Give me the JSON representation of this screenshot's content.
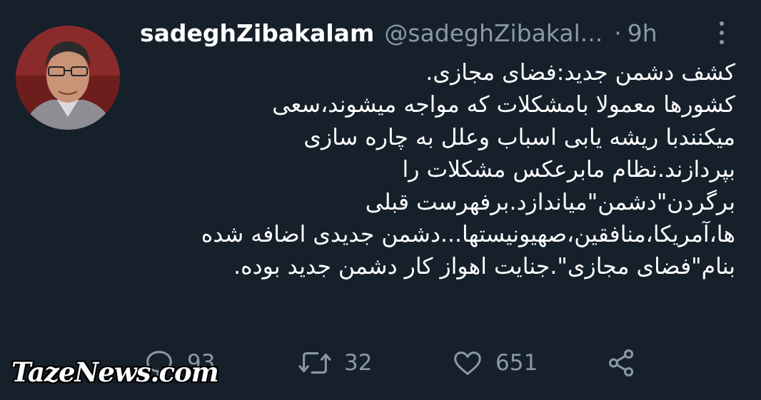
{
  "author": {
    "display_name": "sadeghZibakalam",
    "handle": "@sadeghZibakal...",
    "separator": "·",
    "time": "9h"
  },
  "tweet": {
    "lines": [
      "کشف دشمن جدید:فضای مجازی.",
      " کشورها معمولا بامشکلات که مواجه میشوند،سعی",
      "میکنندبا ریشه یابی اسباب وعلل به چاره سازی",
      "بپردازند.نظام مابرعکس مشکلات را",
      "برگردن\"دشمن\"میاندازد.برفهرست قبلی",
      "ها،آمریکا،منافقین،صهیونیستها...دشمن جدیدی اضافه شده",
      "بنام\"فضای مجازی\".جنایت اهواز کار دشمن جدید بوده."
    ]
  },
  "actions": {
    "reply_count": "93",
    "retweet_count": "32",
    "like_count": "651"
  },
  "watermark": "TazeNews.com",
  "colors": {
    "background": "#15202b",
    "text": "#ffffff",
    "secondary": "#8b98a5"
  }
}
